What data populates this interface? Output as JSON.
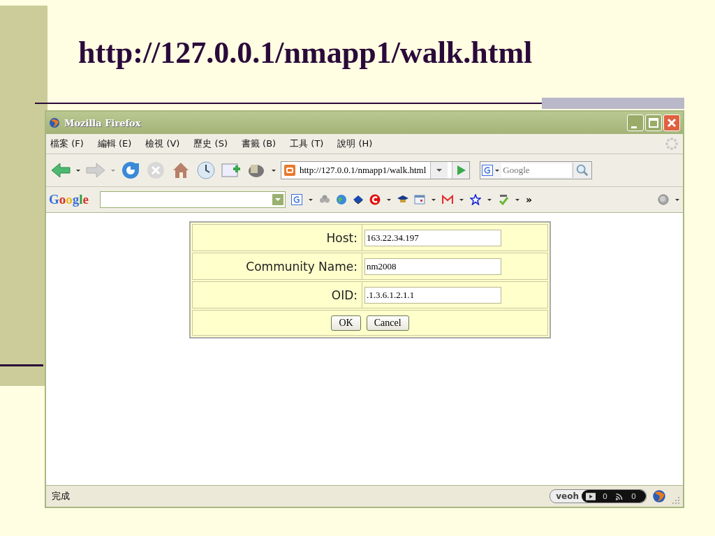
{
  "slide": {
    "title": "http://127.0.0.1/nmapp1/walk.html"
  },
  "window": {
    "title": "Mozilla Firefox"
  },
  "menu": [
    "檔案 (F)",
    "編輯 (E)",
    "檢視 (V)",
    "歷史 (S)",
    "書籤 (B)",
    "工具 (T)",
    "說明 (H)"
  ],
  "navigation": {
    "url": "http://127.0.0.1/nmapp1/walk.html",
    "search_placeholder": "Google"
  },
  "google_toolbar": {
    "logo": "Google",
    "overflow": "»"
  },
  "form": {
    "fields": [
      {
        "label": "Host:",
        "value": "163.22.34.197"
      },
      {
        "label": "Community Name:",
        "value": "nm2008"
      },
      {
        "label": "OID:",
        "value": ".1.3.6.1.2.1.1"
      }
    ],
    "buttons": [
      "OK",
      "Cancel"
    ]
  },
  "status_bar": {
    "text": "完成",
    "veoh": {
      "logo": "veoh",
      "counts": [
        "0",
        "0"
      ]
    }
  }
}
